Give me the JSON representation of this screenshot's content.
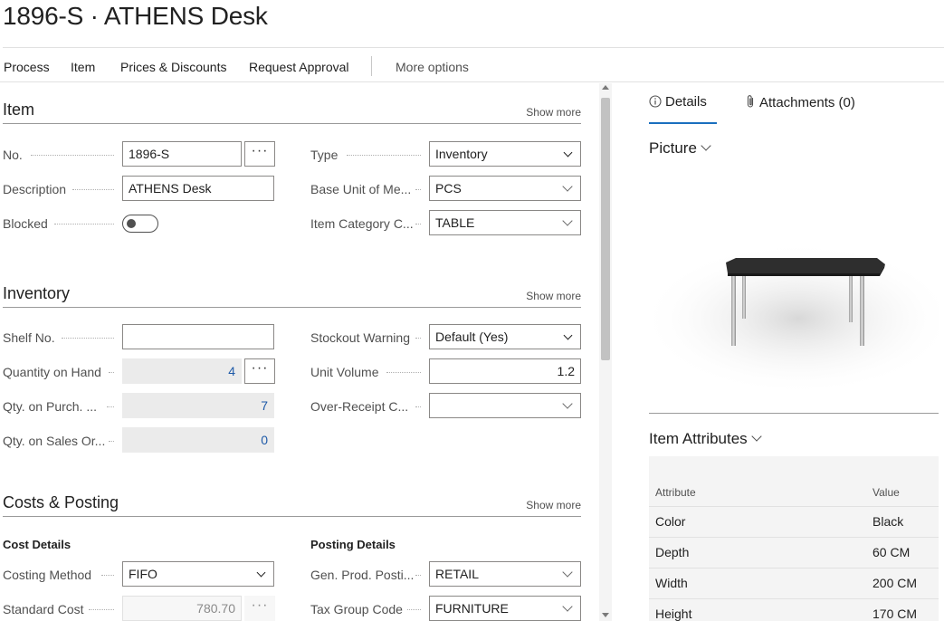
{
  "page": {
    "title": "1896-S · ATHENS Desk"
  },
  "actions": [
    "Process",
    "Item",
    "Prices & Discounts",
    "Request Approval",
    "More options"
  ],
  "sections": {
    "item": {
      "title": "Item",
      "show_more": "Show more",
      "fields": {
        "no": {
          "label": "No.",
          "value": "1896-S"
        },
        "description": {
          "label": "Description",
          "value": "ATHENS Desk"
        },
        "blocked": {
          "label": "Blocked",
          "value": false
        },
        "type": {
          "label": "Type",
          "value": "Inventory"
        },
        "base_unit": {
          "label": "Base Unit of Me...",
          "value": "PCS"
        },
        "item_category": {
          "label": "Item Category C...",
          "value": "TABLE"
        }
      }
    },
    "inventory": {
      "title": "Inventory",
      "show_more": "Show more",
      "fields": {
        "shelf_no": {
          "label": "Shelf No.",
          "value": ""
        },
        "qty_on_hand": {
          "label": "Quantity on Hand",
          "value": "4"
        },
        "qty_on_purch": {
          "label": "Qty. on Purch. ...",
          "value": "7"
        },
        "qty_on_sales": {
          "label": "Qty. on Sales Or...",
          "value": "0"
        },
        "stockout_warning": {
          "label": "Stockout Warning",
          "value": "Default (Yes)"
        },
        "unit_volume": {
          "label": "Unit Volume",
          "value": "1.2"
        },
        "over_receipt": {
          "label": "Over-Receipt C...",
          "value": ""
        }
      }
    },
    "costs": {
      "title": "Costs & Posting",
      "show_more": "Show more",
      "cost_details": "Cost Details",
      "posting_details": "Posting Details",
      "fields": {
        "costing_method": {
          "label": "Costing Method",
          "value": "FIFO"
        },
        "standard_cost": {
          "label": "Standard Cost",
          "value": "780.70"
        },
        "gen_prod_posting": {
          "label": "Gen. Prod. Posti...",
          "value": "RETAIL"
        },
        "tax_group": {
          "label": "Tax Group Code",
          "value": "FURNITURE"
        }
      }
    }
  },
  "factbox": {
    "tabs": {
      "details": "Details",
      "attachments": "Attachments (0)"
    },
    "picture_title": "Picture",
    "attributes_title": "Item Attributes",
    "attributes_header": {
      "attribute": "Attribute",
      "value": "Value"
    },
    "attributes": [
      {
        "attribute": "Color",
        "value": "Black"
      },
      {
        "attribute": "Depth",
        "value": "60 CM"
      },
      {
        "attribute": "Width",
        "value": "200 CM"
      },
      {
        "attribute": "Height",
        "value": "170 CM"
      }
    ]
  },
  "colors": {
    "accent": "#1a6fbe",
    "numeric_text": "#1e5aa8",
    "readonly_bg": "#ebebeb"
  }
}
